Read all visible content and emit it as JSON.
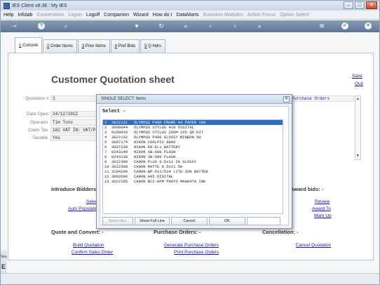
{
  "window": {
    "title": "IES Client v8.36 : My IES",
    "min": "–",
    "max": "□",
    "close": "✕"
  },
  "menu": [
    {
      "label": "Help",
      "dim": false
    },
    {
      "label": "Infolab",
      "dim": false
    },
    {
      "label": "Connections",
      "dim": true
    },
    {
      "label": "Logon",
      "dim": true
    },
    {
      "label": "Logoff",
      "dim": false
    },
    {
      "label": "Companion",
      "dim": false
    },
    {
      "label": "Wizard",
      "dim": false
    },
    {
      "label": "How do I",
      "dim": false
    },
    {
      "label": "DataMarts",
      "dim": false
    },
    {
      "label": "Business Modules",
      "dim": true
    },
    {
      "label": "Action Focus",
      "dim": true
    },
    {
      "label": "Option Select",
      "dim": true
    }
  ],
  "toolbar_icons": [
    "key-icon",
    "help-icon",
    "search-icon",
    "heart-icon",
    "reload-icon",
    "rewind-icon",
    "prev-icon",
    "next-icon",
    "fast-forward-icon",
    "gear-icon",
    "check-icon",
    "close-icon"
  ],
  "tabs": [
    {
      "key": "1",
      "label": " Console",
      "active": true
    },
    {
      "key": "2",
      "label": " Order Items",
      "active": false
    },
    {
      "key": "3",
      "label": " Prior Items",
      "active": false
    },
    {
      "key": "4",
      "label": " Pref Bids",
      "active": false
    },
    {
      "key": "5",
      "label": " Q Hdrs",
      "active": false
    }
  ],
  "sheet": {
    "title": "Customer Quotation sheet",
    "save": "Save",
    "quit": "Quit",
    "quotation_label": "Quotation #",
    "quotation_value": "1",
    "purchase_orders_field": "Purchase Orders",
    "date_open_label": "Date Open",
    "date_open_value": "24/12/2012",
    "operator_label": "Operator",
    "operator_value": "Tim Tono",
    "claim_tax_label": "Claim Tax",
    "claim_tax_value": "102 VAT IN: VAT/P",
    "taxable_label": "Taxable",
    "taxable_value": "Yes"
  },
  "sections": {
    "introduce_bidders": "Introduce Bidders:",
    "award_bids": "Award bids: -",
    "select_partial": "Selec",
    "auto_populate_partial": "Auto Populate",
    "review": "Review",
    "award_to": "Award To",
    "mark_up": "Mark Up",
    "quote_convert": "Quote and Convert: -",
    "purchase_orders": "Purchase Orders: -",
    "cancellation": "Cancellation: -",
    "build_quotation": "Build Quotation",
    "confirm_sales_order": "Confirm Sales Order",
    "generate_purchase_orders": "Generate Purchase Orders",
    "print_purchase_orders": "Print Purchase Orders",
    "cancel_quotation": "Cancel Quotation"
  },
  "dialog": {
    "title": "SINGLE SELECT: Items",
    "close": "✕",
    "header": "Select -",
    "items": [
      {
        "n": "1",
        "code": "3022131",
        "desc": "OLYMPUS P400 FRAME A4 PAPER 100"
      },
      {
        "n": "2",
        "code": "3008044",
        "desc": "OLYMPUS STYLUS 410 DIGITAL"
      },
      {
        "n": "3",
        "code": "0150019",
        "desc": "OLYMPUS STYLUS ZOOM 105 QD KIT"
      },
      {
        "n": "4",
        "code": "3022132",
        "desc": "OLYMPUS P400 GLOSSY RIBBON 50"
      },
      {
        "n": "5",
        "code": "3007174",
        "desc": "NIKON COOLPIX 8800"
      },
      {
        "n": "6",
        "code": "3007230",
        "desc": "NIKON EN-EL1 BATTERY"
      },
      {
        "n": "7",
        "code": "0243140",
        "desc": "NIKON SB-500 FLASH"
      },
      {
        "n": "8",
        "code": "0243138",
        "desc": "NIKON SB-600 FLASH"
      },
      {
        "n": "9",
        "code": "3022308",
        "desc": "CANON PLUS 8.5x11 20 GLOSSY"
      },
      {
        "n": "10",
        "code": "3022300",
        "desc": "CANON MATTE 8.5x11 50"
      },
      {
        "n": "11",
        "code": "3104290",
        "desc": "CANON BP-511/514 LITE-ION BATTER"
      },
      {
        "n": "12",
        "code": "3002096",
        "desc": "CANON A95 DIGITAL"
      },
      {
        "n": "13",
        "code": "3022265",
        "desc": "CANON BCI-6PM PHOTO MAGENTA INK"
      }
    ],
    "buttons": {
      "select_all": "Select ALL",
      "show_full_line": "Show Full Line",
      "cancel": "Cancel",
      "ok": "OK"
    }
  },
  "left_strip": {
    "text": "Ses",
    "letter": "E"
  }
}
